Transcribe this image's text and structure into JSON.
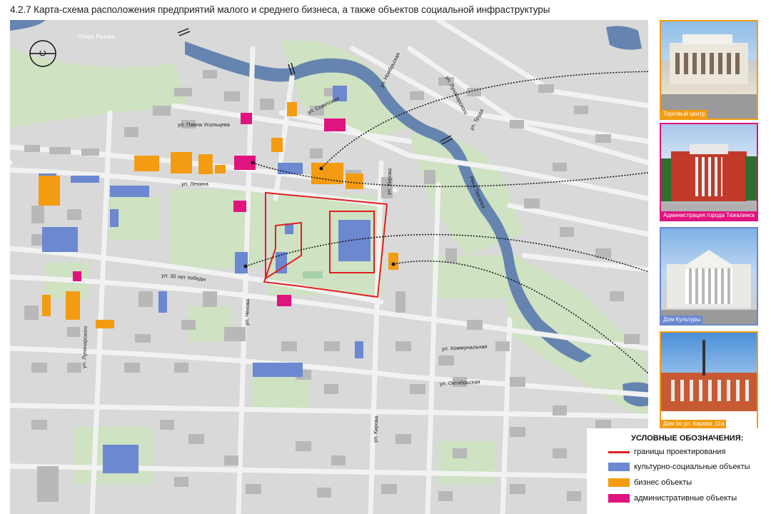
{
  "title": "4.2.7 Карта-схема расположения предприятий малого и среднего бизнеса, а также объектов социальной инфраструктуры",
  "compass_letter": "С",
  "lake_label": "Озеро Разлив",
  "river_label": "Река Тюкалка",
  "streets": {
    "noyabrskaya": "ул. Ноябрьская",
    "lunacharskogo_top": "ул. Луначарского",
    "sovetskaya": "ул. Советская",
    "usoltseva": "ул. Павла Усольцева",
    "truda": "ул. Труда",
    "kirova_top": "ул. Кирова",
    "lenina": "ул. Ленина",
    "pobedy": "ул. 30 лет победы",
    "chekhova": "ул. Чехова",
    "lunacharskogo": "ул. Луначарского",
    "kommunalnaya": "ул. Коммунальная",
    "oktyabrskaya": "ул. Октябрьская",
    "kirova_bottom": "ул. Кирова"
  },
  "photos": [
    {
      "caption": "Торговый центр",
      "frame_color": "#f39c12"
    },
    {
      "caption": "Администрация города Тюкалинск",
      "frame_color": "#e0147f"
    },
    {
      "caption": "Дом Культуры",
      "frame_color": "#6b88d0"
    },
    {
      "caption": "Дом по ул. Кирова ,11а",
      "frame_color": "#f39c12"
    }
  ],
  "legend": {
    "title": "УСЛОВНЫЕ ОБОЗНАЧЕНИЯ:",
    "items": [
      {
        "label": "границы проектирования",
        "color": "#e02020"
      },
      {
        "label": "культурно-социальные объекты",
        "color": "#6b88d0"
      },
      {
        "label": "бизнес объекты",
        "color": "#f39c12"
      },
      {
        "label": "административные объекты",
        "color": "#e0147f"
      }
    ]
  },
  "colors": {
    "background": "#d9d9d9",
    "road": "#f2f2f2",
    "building": "#b8b8b8",
    "green": "#cfe2c2",
    "water": "#6585b0",
    "cultural": "#6b88d0",
    "business": "#f39c12",
    "administrative": "#e0147f",
    "boundary": "#e02020"
  }
}
